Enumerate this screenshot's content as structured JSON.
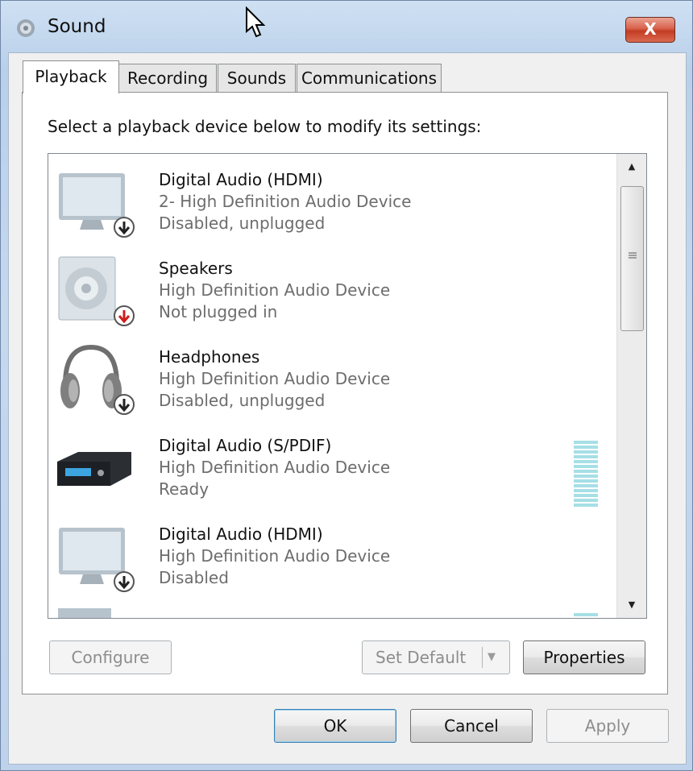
{
  "window": {
    "title": "Sound",
    "close_label": "X"
  },
  "tabs": [
    {
      "label": "Playback",
      "active": true
    },
    {
      "label": "Recording",
      "active": false
    },
    {
      "label": "Sounds",
      "active": false
    },
    {
      "label": "Communications",
      "active": false
    }
  ],
  "playback": {
    "instruction": "Select a playback device below to modify its settings:",
    "devices": [
      {
        "name": "Digital Audio (HDMI)",
        "description": "2- High Definition Audio Device",
        "status": "Disabled, unplugged",
        "icon": "monitor-icon",
        "badge": "down-arrow-badge"
      },
      {
        "name": "Speakers",
        "description": "High Definition Audio Device",
        "status": "Not plugged in",
        "icon": "speaker-icon",
        "badge": "red-down-arrow-badge"
      },
      {
        "name": "Headphones",
        "description": "High Definition Audio Device",
        "status": "Disabled, unplugged",
        "icon": "headphones-icon",
        "badge": "down-arrow-badge"
      },
      {
        "name": "Digital Audio (S/PDIF)",
        "description": "High Definition Audio Device",
        "status": "Ready",
        "icon": "receiver-icon",
        "badge": null
      },
      {
        "name": "Digital Audio (HDMI)",
        "description": "High Definition Audio Device",
        "status": "Disabled",
        "icon": "monitor-icon",
        "badge": "down-arrow-badge"
      }
    ],
    "buttons": {
      "configure": "Configure",
      "set_default": "Set Default",
      "properties": "Properties"
    }
  },
  "dialog_buttons": {
    "ok": "OK",
    "cancel": "Cancel",
    "apply": "Apply"
  },
  "colors": {
    "accent": "#3c7fb1",
    "close": "#c33c24",
    "meter": "#a6dfe6",
    "secondary_text": "#6d6d6d"
  }
}
